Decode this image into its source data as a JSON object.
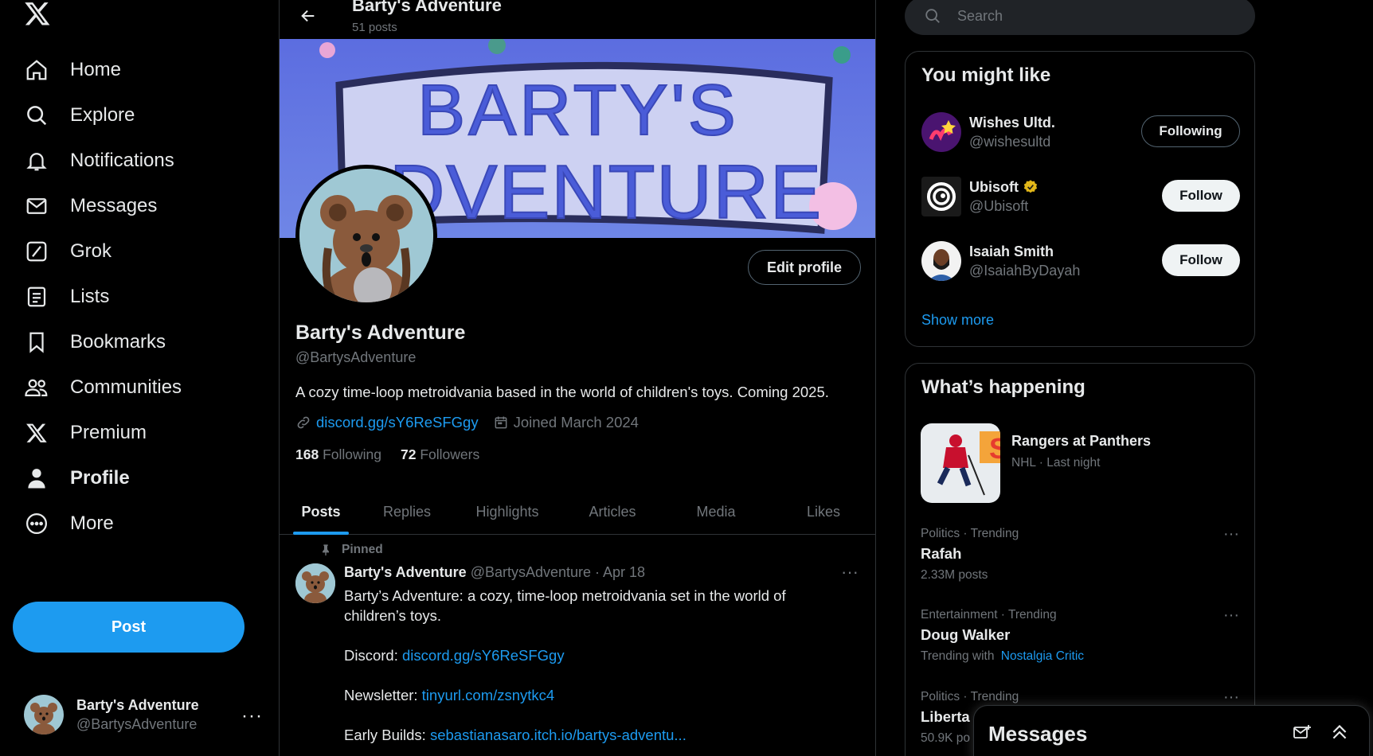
{
  "nav": {
    "items": [
      {
        "label": "Home",
        "icon": "home-icon"
      },
      {
        "label": "Explore",
        "icon": "search-icon"
      },
      {
        "label": "Notifications",
        "icon": "bell-icon"
      },
      {
        "label": "Messages",
        "icon": "mail-icon"
      },
      {
        "label": "Grok",
        "icon": "grok-icon"
      },
      {
        "label": "Lists",
        "icon": "list-icon"
      },
      {
        "label": "Bookmarks",
        "icon": "bookmark-icon"
      },
      {
        "label": "Communities",
        "icon": "people-icon"
      },
      {
        "label": "Premium",
        "icon": "x-logo-icon"
      },
      {
        "label": "Profile",
        "icon": "person-icon"
      },
      {
        "label": "More",
        "icon": "more-circle-icon"
      }
    ],
    "post_label": "Post",
    "account": {
      "name": "Barty's Adventure",
      "handle": "@BartysAdventure",
      "menu": "···"
    }
  },
  "header": {
    "title": "Barty's Adventure",
    "subtitle": "51 posts"
  },
  "profile": {
    "name": "Barty's Adventure",
    "handle": "@BartysAdventure",
    "edit_label": "Edit profile",
    "bio": "A cozy time-loop metroidvania based in the world of children's toys. Coming 2025.",
    "link": "discord.gg/sY6ReSFGgy",
    "joined": "Joined March 2024",
    "following_count": "168",
    "following_label": "Following",
    "followers_count": "72",
    "followers_label": "Followers"
  },
  "tabs": [
    "Posts",
    "Replies",
    "Highlights",
    "Articles",
    "Media",
    "Likes"
  ],
  "pinned_tweet": {
    "pinned_label": "Pinned",
    "name": "Barty's Adventure",
    "handle_date": "@BartysAdventure · Apr 18",
    "text": "Barty’s Adventure: a cozy, time-loop metroidvania set in the world of children’s toys.",
    "discord_label": "Discord:",
    "discord_link": "discord.gg/sY6ReSFGgy",
    "newsletter_label": "Newsletter:",
    "newsletter_link": "tinyurl.com/zsnytkc4",
    "builds_label": "Early Builds:",
    "builds_link": "sebastianasaro.itch.io/bartys-adventu..."
  },
  "search": {
    "placeholder": "Search"
  },
  "might_like": {
    "title": "You might like",
    "users": [
      {
        "name": "Wishes Ultd.",
        "handle": "@wishesultd",
        "button": "Following"
      },
      {
        "name": "Ubisoft",
        "handle": "@Ubisoft",
        "button": "Follow",
        "verified": true
      },
      {
        "name": "Isaiah Smith",
        "handle": "@IsaiahByDayah",
        "button": "Follow"
      }
    ],
    "show_more": "Show more"
  },
  "happening": {
    "title": "What’s happening",
    "news": {
      "title": "Rangers at Panthers",
      "meta": "NHL · Last night"
    },
    "trends": [
      {
        "category": "Politics · Trending",
        "topic": "Rafah",
        "count": "2.33M posts"
      },
      {
        "category": "Entertainment · Trending",
        "topic": "Doug Walker",
        "count": "Trending with",
        "with_link": "Nostalgia Critic"
      },
      {
        "category": "Politics · Trending",
        "topic": "Liberta",
        "count": "50.9K po"
      }
    ]
  },
  "messages_drawer": {
    "title": "Messages"
  },
  "colors": {
    "accent": "#1d9bf0",
    "background": "#000000",
    "text": "#e7e9ea",
    "muted": "#71767b",
    "border": "#2f3336"
  }
}
